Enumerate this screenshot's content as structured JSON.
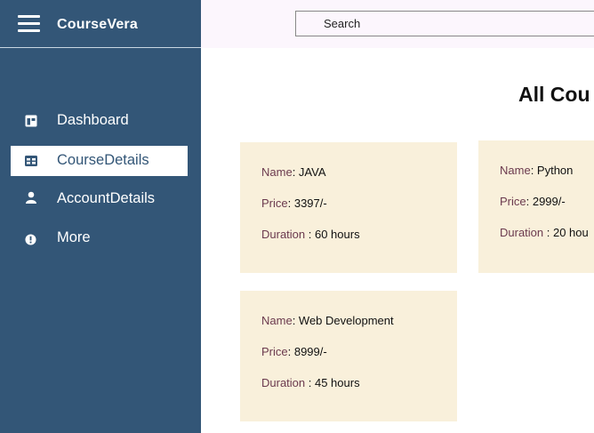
{
  "sidebar": {
    "brand": "CourseVera",
    "items": [
      {
        "label": "Dashboard",
        "icon": "dashboard-icon"
      },
      {
        "label": "CourseDetails",
        "icon": "table-icon",
        "active": true
      },
      {
        "label": "AccountDetails",
        "icon": "user-icon"
      },
      {
        "label": "More",
        "icon": "info-circle-icon"
      }
    ]
  },
  "header": {
    "search_placeholder": "Search"
  },
  "main": {
    "title": "All Cou",
    "courses": [
      {
        "name_key": "Name",
        "name": ": JAVA",
        "price_key": "Price",
        "price": ": 3397/-",
        "duration_key": "Duration",
        "duration": " : 60 hours"
      },
      {
        "name_key": "Name",
        "name": ": Python",
        "price_key": "Price",
        "price": ": 2999/-",
        "duration_key": "Duration",
        "duration": " : 20 hou"
      },
      {
        "name_key": "Name",
        "name": ": Web Development",
        "price_key": "Price",
        "price": ": 8999/-",
        "duration_key": "Duration",
        "duration": " : 45 hours"
      }
    ]
  },
  "colors": {
    "sidebar_bg": "#335677",
    "header_bg": "#fcf6fd",
    "card_bg": "#f9f0db",
    "label_color": "#6b3a4e"
  }
}
